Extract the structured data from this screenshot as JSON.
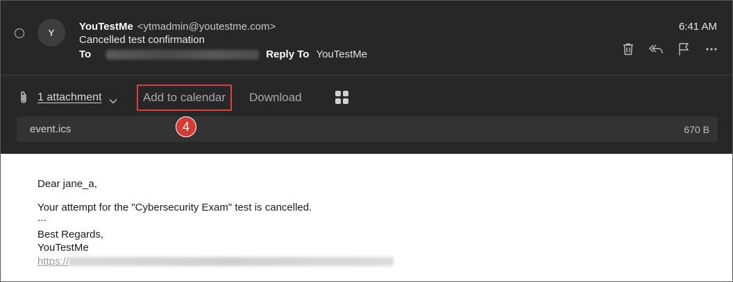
{
  "header": {
    "avatar_initial": "Y",
    "sender_name": "YouTestMe",
    "sender_email": "<ytmadmin@youtestme.com>",
    "subject": "Cancelled test confirmation",
    "to_label": "To",
    "reply_to_label": "Reply To",
    "reply_to_value": "YouTestMe",
    "time": "6:41 AM",
    "action_icons": [
      "trash-icon",
      "reply-all-icon",
      "flag-icon",
      "more-icon"
    ]
  },
  "attachments": {
    "count_label": "1 attachment",
    "add_to_calendar_label": "Add to calendar",
    "download_label": "Download",
    "step_badge": "4",
    "file": {
      "name": "event.ics",
      "size": "670 B"
    }
  },
  "body": {
    "greeting": "Dear jane_a,",
    "message": "Your attempt for the \"Cybersecurity Exam\" test is cancelled.",
    "ellipsis": "...",
    "closing": "Best Regards,",
    "signature": "YouTestMe",
    "link_prefix": "https://"
  },
  "colors": {
    "header_bg": "#272727",
    "highlight_border": "#d9423e",
    "badge_bg": "#d53b34"
  }
}
